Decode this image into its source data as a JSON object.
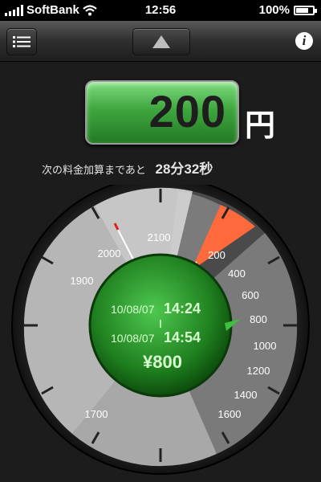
{
  "status_bar": {
    "carrier": "SoftBank",
    "time": "12:56",
    "battery": "100%"
  },
  "nav": {
    "menu_icon": "list-icon",
    "up_icon": "up-arrow-icon",
    "info_label": "i"
  },
  "fare": {
    "value": "200",
    "unit": "円"
  },
  "next_fare": {
    "label": "次の料金加算まであと",
    "time": "28分32秒"
  },
  "gauge": {
    "labels": [
      "1700",
      "1900",
      "2000",
      "2100",
      "200",
      "400",
      "600",
      "800",
      "1000",
      "1200",
      "1400",
      "1600"
    ],
    "start_date": "10/08/07",
    "start_time": "14:24",
    "end_date": "10/08/07",
    "end_time": "14:54",
    "total": "¥800"
  },
  "colors": {
    "accent_green": "#3fa63f",
    "highlight_orange": "#ff6a3c"
  }
}
